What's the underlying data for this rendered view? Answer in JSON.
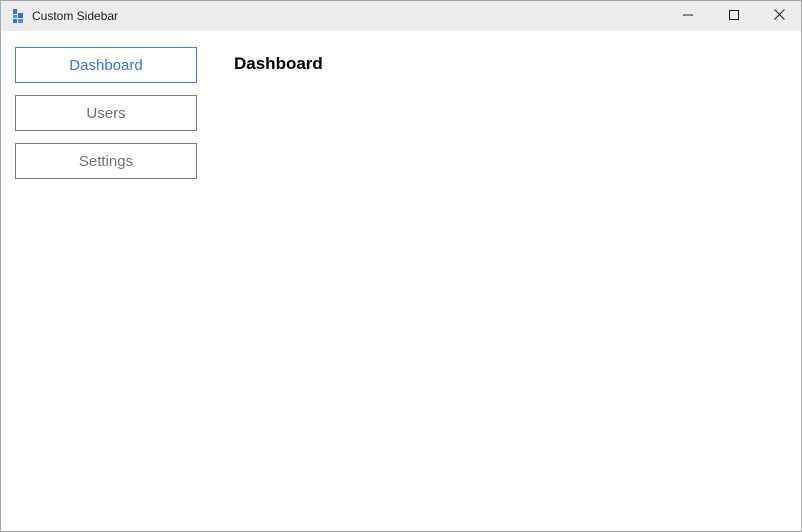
{
  "window": {
    "title": "Custom Sidebar",
    "app_icon": "app-logo-icon",
    "controls": {
      "minimize": "minimize-icon",
      "maximize": "maximize-icon",
      "close": "close-icon"
    }
  },
  "sidebar": {
    "items": [
      {
        "label": "Dashboard",
        "active": true
      },
      {
        "label": "Users",
        "active": false
      },
      {
        "label": "Settings",
        "active": false
      }
    ]
  },
  "main": {
    "title": "Dashboard"
  },
  "colors": {
    "accent": "#3f6fe0",
    "inactive_text": "#707070",
    "titlebar_bg": "#ececec"
  }
}
